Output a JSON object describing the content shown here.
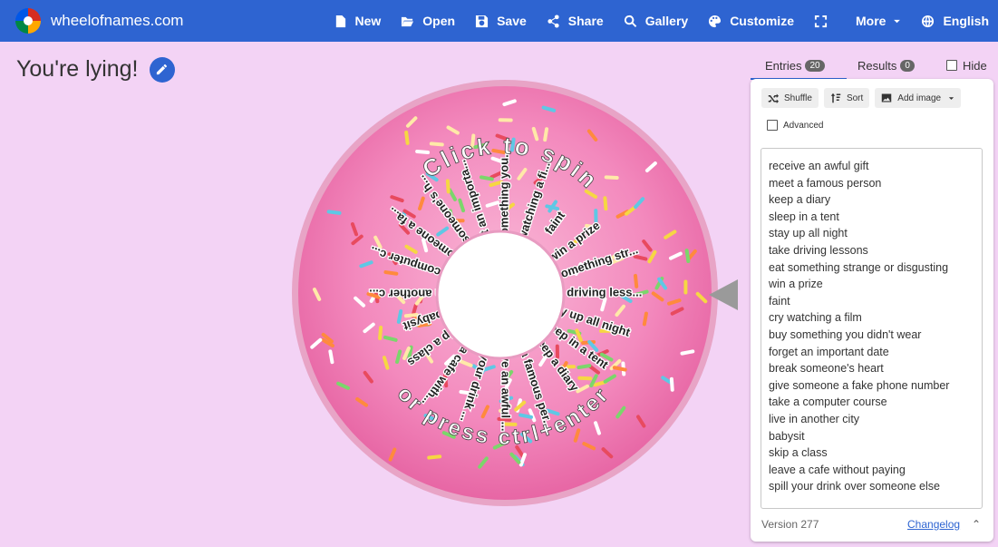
{
  "topbar": {
    "brand": "wheelofnames.com",
    "menu": [
      {
        "label": "New",
        "icon": "file-icon"
      },
      {
        "label": "Open",
        "icon": "folder-open-icon"
      },
      {
        "label": "Save",
        "icon": "save-icon"
      },
      {
        "label": "Share",
        "icon": "share-icon"
      },
      {
        "label": "Gallery",
        "icon": "search-icon"
      },
      {
        "label": "Customize",
        "icon": "palette-icon"
      },
      {
        "label": "",
        "icon": "fullscreen-icon"
      },
      {
        "label": "More",
        "icon": "chevron-down-icon"
      },
      {
        "label": "English",
        "icon": "globe-icon"
      }
    ]
  },
  "title": "You're lying!",
  "wheel": {
    "center_text_top": "Click to spin",
    "center_text_bottom": "or press ctrl+enter",
    "labels": [
      "take driving less...",
      "stay up all night",
      "sleep in a tent",
      "keep a diary",
      "meet a famous per...",
      "receive an awful ...",
      "spill your drink ...",
      "leave a cafe with...",
      "skip a class",
      "babysit",
      "live in another c...",
      "take a computer c...",
      "give someone a fa...",
      "break someone's h...",
      "forget an importa...",
      "buy something you...",
      "cry watching a fi...",
      "faint",
      "win a prize",
      "eat something str..."
    ],
    "colors": {
      "dough": "#f7a3c9",
      "icing": "#ef6fab"
    }
  },
  "tabs": {
    "entries_label": "Entries",
    "entries_count": "20",
    "results_label": "Results",
    "results_count": "0",
    "hide_label": "Hide"
  },
  "tools": {
    "shuffle": "Shuffle",
    "sort": "Sort",
    "add_image": "Add image",
    "advanced": "Advanced"
  },
  "entries": [
    "receive an awful gift",
    "meet a famous person",
    "keep a diary",
    "sleep in a tent",
    "stay up all night",
    "take driving lessons",
    "eat something strange or disgusting",
    "win a prize",
    "faint",
    "cry watching a film",
    "buy something you didn't wear",
    "forget an important date",
    "break someone's heart",
    "give someone a fake phone number",
    "take a computer course",
    "live in another city",
    "babysit",
    "skip a class",
    "leave a cafe without paying",
    "spill your drink over someone else"
  ],
  "footer": {
    "version": "Version 277",
    "changelog": "Changelog"
  }
}
